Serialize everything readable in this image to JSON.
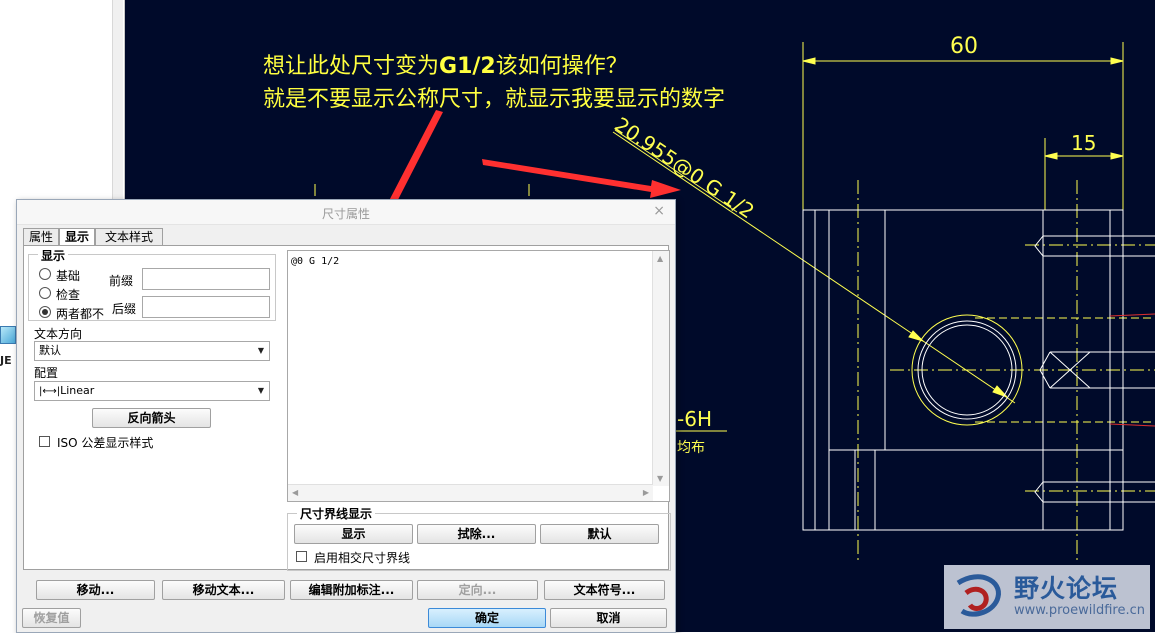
{
  "annotation": {
    "line1_prefix": "想让此处尺寸变为",
    "line1_bold": "G1/2",
    "line1_suffix": "该如何操作？",
    "line2": "就是不要显示公称尺寸，就显示我要显示的数字"
  },
  "drawing": {
    "dim_60": "60",
    "dim_15": "15",
    "dim_diameter": "20.955@0 G 1/2",
    "thread_note": "-6H",
    "thread_note_2": "均布"
  },
  "left_panel": {
    "label": "JE"
  },
  "dialog": {
    "title": "尺寸属性",
    "close": "×",
    "tabs": [
      "属性",
      "显示",
      "文本样式"
    ],
    "display_group": {
      "legend": "显示",
      "radios": [
        "基础",
        "检查",
        "两者都不"
      ],
      "prefix_label": "前缀",
      "suffix_label": "后缀",
      "prefix_value": "",
      "suffix_value": ""
    },
    "text_direction": {
      "label": "文本方向",
      "value": "默认"
    },
    "config": {
      "label": "配置",
      "value": "Linear"
    },
    "reverse_arrow": "反向箭头",
    "iso_checkbox": "ISO 公差显示样式",
    "text_value": "@0 G 1/2",
    "witness_group": {
      "legend": "尺寸界线显示",
      "buttons": [
        "显示",
        "拭除...",
        "默认"
      ],
      "checkbox": "启用相交尺寸界线"
    },
    "bottom_buttons": [
      "移动...",
      "移动文本...",
      "编辑附加标注...",
      "定向...",
      "文本符号..."
    ],
    "footer": {
      "restore": "恢复值",
      "ok": "确定",
      "cancel": "取消"
    }
  },
  "watermark": {
    "name": "野火论坛",
    "url": "www.proewildfire.cn"
  },
  "colors": {
    "cad_background": "#000a2a",
    "annotation": "#ffff40",
    "arrow": "#ff3030"
  }
}
